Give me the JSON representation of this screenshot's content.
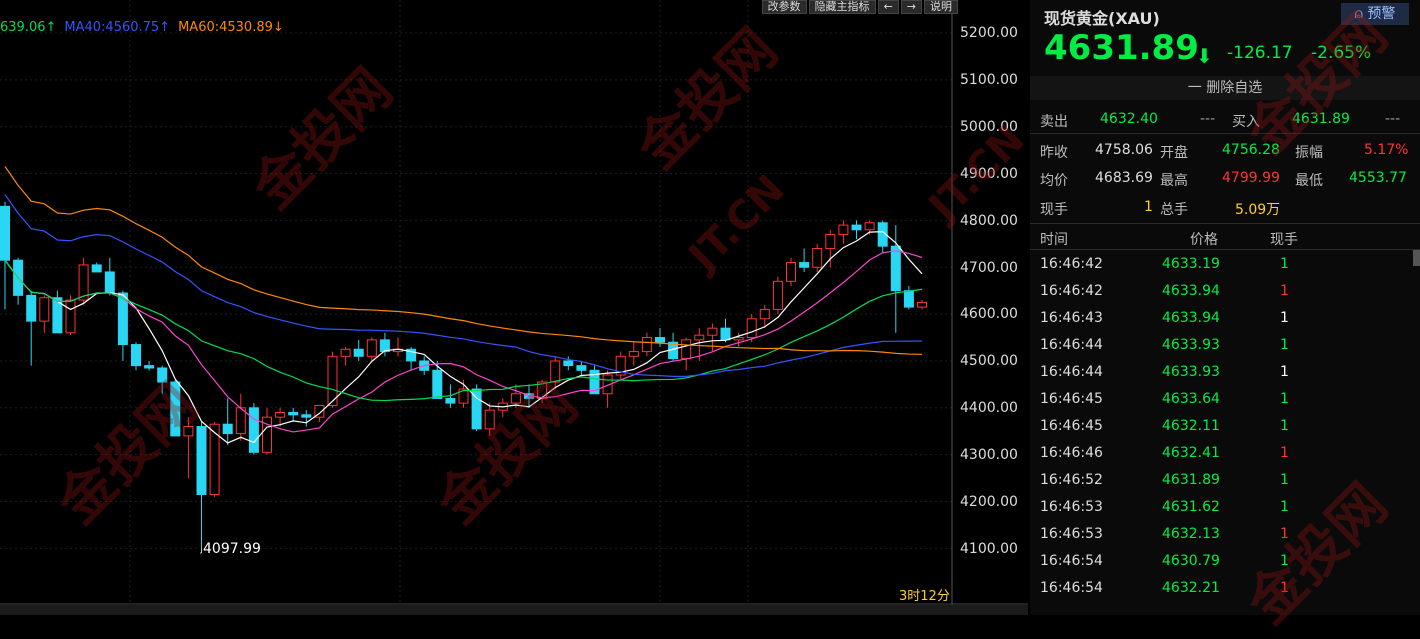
{
  "toolbar": {
    "buttons": [
      "改参数",
      "隐藏主指标",
      "←",
      "→",
      "说明"
    ]
  },
  "ma_legend": [
    {
      "text": "639.06↑",
      "color": "#00dd55"
    },
    {
      "text": "MA40:4560.75↑",
      "color": "#3355ff"
    },
    {
      "text": "MA60:4530.89↓",
      "color": "#ff8800"
    }
  ],
  "y_axis": [
    "5200.00",
    "5100.00",
    "5000.00",
    "4900.00",
    "4800.00",
    "4700.00",
    "4600.00",
    "4500.00",
    "4400.00",
    "4300.00",
    "4200.00",
    "4100.00"
  ],
  "low_marker": "4097.99",
  "time_left": "3时12分",
  "watermark": {
    "brand": "金投网",
    "url": "JT.CN"
  },
  "panel": {
    "title": "现货黄金(XAU)",
    "alert_btn": "预警",
    "price": "4631.89",
    "change": "-126.17",
    "change_pct": "-2.65%",
    "remove_btn": "一 删除自选",
    "sell_label": "卖出",
    "sell_value": "4632.40",
    "sell_vol": "---",
    "buy_label": "买入",
    "buy_value": "4631.89",
    "buy_vol": "---",
    "stats": [
      [
        {
          "label": "昨收",
          "value": "4758.06",
          "color": "#ddd"
        },
        {
          "label": "开盘",
          "value": "4756.28",
          "color": "#00ee44"
        },
        {
          "label": "振幅",
          "value": "5.17%",
          "color": "#ff3333"
        }
      ],
      [
        {
          "label": "均价",
          "value": "4683.69",
          "color": "#ddd"
        },
        {
          "label": "最高",
          "value": "4799.99",
          "color": "#ff3333"
        },
        {
          "label": "最低",
          "value": "4553.77",
          "color": "#00ee44"
        }
      ],
      [
        {
          "label": "现手",
          "value": "1",
          "color": "#ffcc33"
        },
        {
          "label": "总手",
          "value": "5.09万",
          "color": "#ffcc33"
        }
      ]
    ],
    "tick_headers": [
      "时间",
      "价格",
      "现手"
    ],
    "ticks": [
      {
        "time": "16:46:42",
        "price": "4633.19",
        "vol": "1",
        "vc": "#00ee44"
      },
      {
        "time": "16:46:42",
        "price": "4633.94",
        "vol": "1",
        "vc": "#ff3333"
      },
      {
        "time": "16:46:43",
        "price": "4633.94",
        "vol": "1",
        "vc": "#ffffff"
      },
      {
        "time": "16:46:44",
        "price": "4633.93",
        "vol": "1",
        "vc": "#00ee44"
      },
      {
        "time": "16:46:44",
        "price": "4633.93",
        "vol": "1",
        "vc": "#ffffff"
      },
      {
        "time": "16:46:45",
        "price": "4633.64",
        "vol": "1",
        "vc": "#00ee44"
      },
      {
        "time": "16:46:45",
        "price": "4632.11",
        "vol": "1",
        "vc": "#00ee44"
      },
      {
        "time": "16:46:46",
        "price": "4632.41",
        "vol": "1",
        "vc": "#ff3333"
      },
      {
        "time": "16:46:52",
        "price": "4631.89",
        "vol": "1",
        "vc": "#00ee44"
      },
      {
        "time": "16:46:53",
        "price": "4631.62",
        "vol": "1",
        "vc": "#00ee44"
      },
      {
        "time": "16:46:53",
        "price": "4632.13",
        "vol": "1",
        "vc": "#ff3333"
      },
      {
        "time": "16:46:54",
        "price": "4630.79",
        "vol": "1",
        "vc": "#00ee44"
      },
      {
        "time": "16:46:54",
        "price": "4632.21",
        "vol": "1",
        "vc": "#ff3333"
      }
    ]
  },
  "candles": [
    [
      4830,
      4840,
      4610,
      4715
    ],
    [
      4715,
      4720,
      4620,
      4640
    ],
    [
      4640,
      4650,
      4490,
      4585
    ],
    [
      4585,
      4640,
      4560,
      4635
    ],
    [
      4635,
      4650,
      4580,
      4560
    ],
    [
      4560,
      4640,
      4555,
      4630
    ],
    [
      4630,
      4720,
      4620,
      4705
    ],
    [
      4705,
      4710,
      4690,
      4690
    ],
    [
      4690,
      4720,
      4640,
      4645
    ],
    [
      4645,
      4650,
      4500,
      4535
    ],
    [
      4535,
      4540,
      4480,
      4490
    ],
    [
      4490,
      4500,
      4480,
      4485
    ],
    [
      4485,
      4490,
      4430,
      4455
    ],
    [
      4455,
      4460,
      4340,
      4340
    ],
    [
      4340,
      4380,
      4250,
      4360
    ],
    [
      4360,
      4370,
      4100,
      4215
    ],
    [
      4215,
      4370,
      4210,
      4365
    ],
    [
      4365,
      4420,
      4320,
      4345
    ],
    [
      4345,
      4430,
      4330,
      4400
    ],
    [
      4400,
      4410,
      4300,
      4305
    ],
    [
      4305,
      4400,
      4300,
      4380
    ],
    [
      4380,
      4400,
      4360,
      4390
    ],
    [
      4390,
      4400,
      4370,
      4385
    ],
    [
      4385,
      4395,
      4360,
      4380
    ],
    [
      4380,
      4400,
      4370,
      4405
    ],
    [
      4405,
      4520,
      4400,
      4510
    ],
    [
      4510,
      4530,
      4490,
      4525
    ],
    [
      4525,
      4545,
      4500,
      4510
    ],
    [
      4510,
      4550,
      4500,
      4545
    ],
    [
      4545,
      4560,
      4510,
      4520
    ],
    [
      4520,
      4550,
      4510,
      4525
    ],
    [
      4525,
      4530,
      4480,
      4500
    ],
    [
      4500,
      4510,
      4470,
      4480
    ],
    [
      4480,
      4500,
      4430,
      4420
    ],
    [
      4420,
      4450,
      4400,
      4410
    ],
    [
      4410,
      4460,
      4400,
      4440
    ],
    [
      4440,
      4450,
      4350,
      4355
    ],
    [
      4355,
      4410,
      4340,
      4395
    ],
    [
      4395,
      4420,
      4380,
      4410
    ],
    [
      4410,
      4450,
      4400,
      4430
    ],
    [
      4430,
      4450,
      4400,
      4420
    ],
    [
      4420,
      4460,
      4410,
      4455
    ],
    [
      4455,
      4510,
      4440,
      4500
    ],
    [
      4500,
      4510,
      4480,
      4490
    ],
    [
      4490,
      4500,
      4470,
      4480
    ],
    [
      4480,
      4490,
      4430,
      4430
    ],
    [
      4430,
      4480,
      4400,
      4470
    ],
    [
      4470,
      4520,
      4460,
      4510
    ],
    [
      4510,
      4540,
      4490,
      4520
    ],
    [
      4520,
      4560,
      4510,
      4550
    ],
    [
      4550,
      4570,
      4530,
      4540
    ],
    [
      4540,
      4560,
      4500,
      4505
    ],
    [
      4505,
      4550,
      4480,
      4545
    ],
    [
      4545,
      4570,
      4500,
      4555
    ],
    [
      4555,
      4580,
      4520,
      4570
    ],
    [
      4570,
      4590,
      4540,
      4545
    ],
    [
      4545,
      4560,
      4530,
      4550
    ],
    [
      4550,
      4600,
      4540,
      4590
    ],
    [
      4590,
      4620,
      4570,
      4610
    ],
    [
      4610,
      4680,
      4600,
      4670
    ],
    [
      4670,
      4720,
      4660,
      4710
    ],
    [
      4710,
      4740,
      4690,
      4700
    ],
    [
      4700,
      4750,
      4690,
      4740
    ],
    [
      4740,
      4780,
      4700,
      4770
    ],
    [
      4770,
      4800,
      4750,
      4790
    ],
    [
      4790,
      4800,
      4760,
      4780
    ],
    [
      4780,
      4800,
      4770,
      4795
    ],
    [
      4795,
      4800,
      4730,
      4745
    ],
    [
      4745,
      4790,
      4560,
      4650
    ],
    [
      4650,
      4660,
      4610,
      4615
    ],
    [
      4615,
      4630,
      4610,
      4625
    ]
  ]
}
